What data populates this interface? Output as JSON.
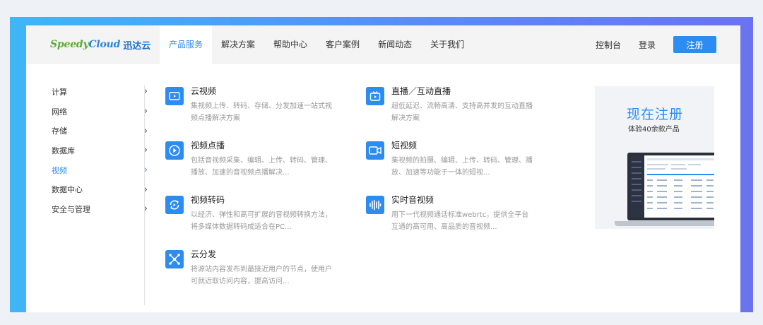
{
  "brand": {
    "logo_en_a": "Speedy",
    "logo_en_b": "Cl",
    "logo_en_c": "o",
    "logo_en_d": "ud",
    "logo_cn": "迅达云"
  },
  "nav": {
    "items": [
      {
        "label": "产品服务",
        "active": true
      },
      {
        "label": "解决方案"
      },
      {
        "label": "帮助中心"
      },
      {
        "label": "客户案例"
      },
      {
        "label": "新闻动态"
      },
      {
        "label": "关于我们"
      }
    ],
    "console": "控制台",
    "login": "登录",
    "register": "注册"
  },
  "sidebar": {
    "items": [
      {
        "label": "计算"
      },
      {
        "label": "网络"
      },
      {
        "label": "存储"
      },
      {
        "label": "数据库"
      },
      {
        "label": "视频",
        "active": true
      },
      {
        "label": "数据中心"
      },
      {
        "label": "安全与管理"
      }
    ]
  },
  "products": [
    {
      "title": "云视频",
      "desc": "集视频上传、转码、存储、分发加速一站式视频点播解决方案",
      "icon": "video-camera-icon"
    },
    {
      "title": "直播／互动直播",
      "desc": "超低延迟、流畅高清、支持高并发的互动直播解决方案",
      "icon": "tv-icon"
    },
    {
      "title": "视频点播",
      "desc": "包括音视频采集、编辑、上传、转码、管理、播放、加速的音视频点播解决...",
      "icon": "play-icon"
    },
    {
      "title": "短视频",
      "desc": "集视频的拍摄、编辑、上传、转码、管理、播放、加速等功能于一体的短视...",
      "icon": "camcorder-icon"
    },
    {
      "title": "视频转码",
      "desc": "以经济、弹性和高可扩展的音视频转换方法，将多媒体数据转码成适合在PC...",
      "icon": "transcode-icon"
    },
    {
      "title": "实时音视频",
      "desc": "用下一代视频通话标准webrtc，提供全平台互通的高可用、高品质的音视频...",
      "icon": "audio-wave-icon"
    },
    {
      "title": "云分发",
      "desc": "将源站内容发布到最接近用户的节点，使用户可就近取访问内容，提高访问...",
      "icon": "distribution-icon"
    }
  ],
  "promo": {
    "title": "现在注册",
    "subtitle": "体验40余款产品"
  },
  "colors": {
    "accent": "#2d8cf0",
    "header_bg": "#f4f4f5",
    "logo_green": "#5aa83a"
  }
}
